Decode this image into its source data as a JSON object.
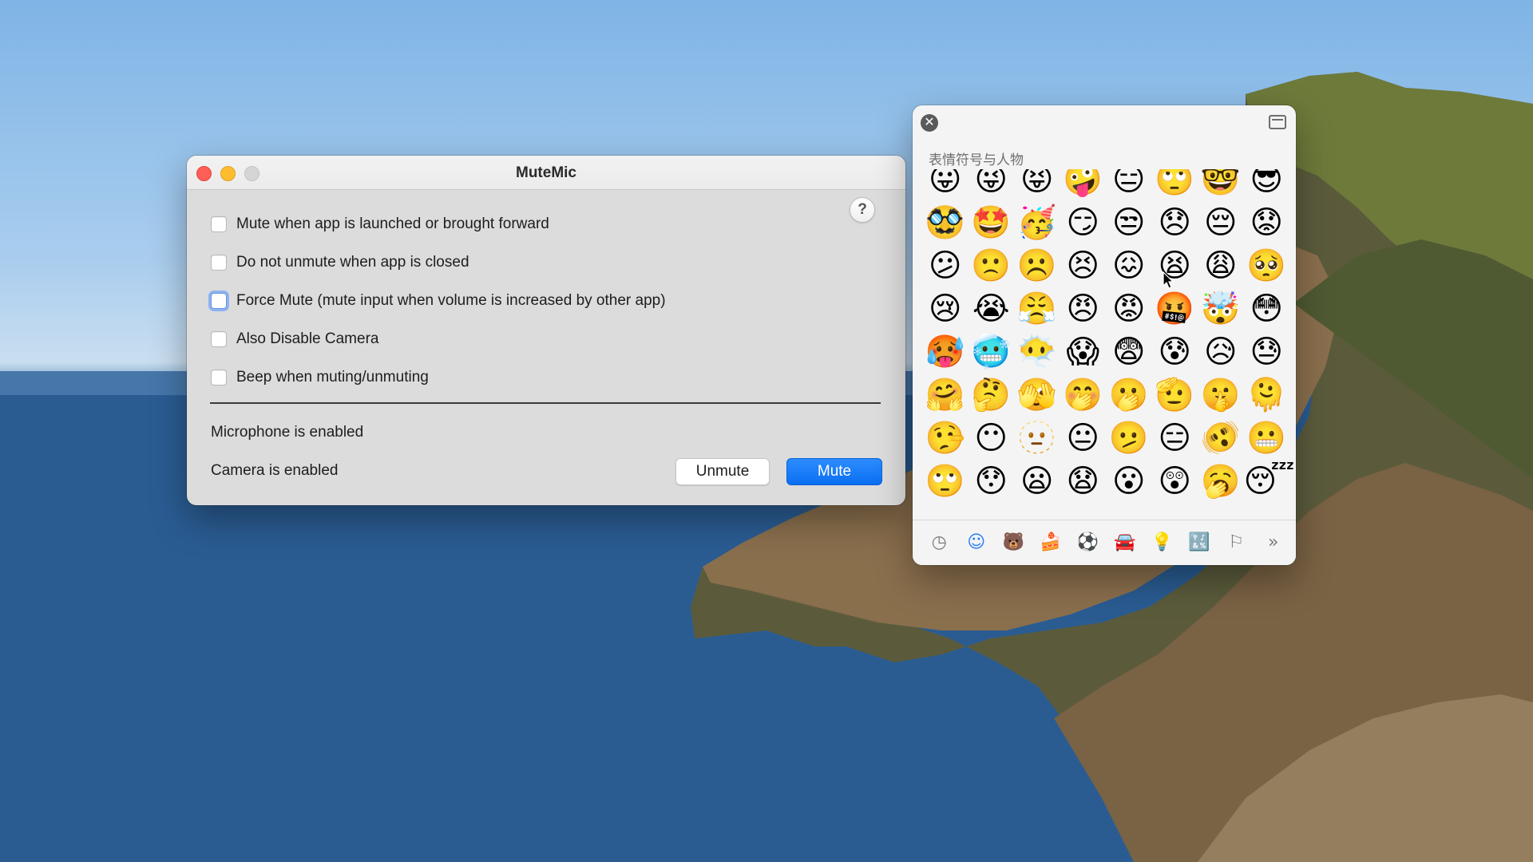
{
  "desktop": {
    "wallpaper": "macOS Catalina island",
    "accent": "#0a6ff2"
  },
  "mutemic": {
    "title": "MuteMic",
    "help_label": "?",
    "options": [
      {
        "label": "Mute when app is launched or brought forward",
        "checked": false,
        "focused": false
      },
      {
        "label": "Do not unmute when app is closed",
        "checked": false,
        "focused": false
      },
      {
        "label": "Force Mute (mute input when volume is increased by other app)",
        "checked": false,
        "focused": true
      },
      {
        "label": "Also Disable Camera",
        "checked": false,
        "focused": false
      },
      {
        "label": "Beep when muting/unmuting",
        "checked": false,
        "focused": false
      }
    ],
    "status_microphone": "Microphone is enabled",
    "status_camera": "Camera is enabled",
    "unmute_label": "Unmute",
    "mute_label": "Mute"
  },
  "emoji_picker": {
    "category_title": "表情符号与人物",
    "rows": [
      [
        "😛",
        "😜",
        "😝",
        "🤪",
        "😑",
        "🙄",
        "🤓",
        "😎"
      ],
      [
        "🥸",
        "🤩",
        "🥳",
        "😏",
        "😒",
        "😞",
        "😔",
        "😟"
      ],
      [
        "😕",
        "🙁",
        "☹️",
        "😣",
        "😖",
        "😫",
        "😩",
        "🥺"
      ],
      [
        "😢",
        "😭",
        "😤",
        "😠",
        "😡",
        "🤬",
        "🤯",
        "😳"
      ],
      [
        "🥵",
        "🥶",
        "😶‍🌫️",
        "😱",
        "😨",
        "😰",
        "😥",
        "😓"
      ],
      [
        "🤗",
        "🤔",
        "🫣",
        "🤭",
        "🫢",
        "🫡",
        "🤫",
        "🫠"
      ],
      [
        "🤥",
        "😶",
        "🫥",
        "😐",
        "🫤",
        "😑",
        "🫨",
        "😬"
      ],
      [
        "🙄",
        "😯",
        "😦",
        "😧",
        "😮",
        "😲",
        "🥱",
        "😴"
      ],
      [
        "😌",
        "😒",
        "😔",
        "😵",
        "😵‍💫",
        "😶",
        "🥴",
        "🤢"
      ]
    ],
    "tabs": [
      {
        "name": "recent",
        "glyph": "◷",
        "active": false
      },
      {
        "name": "smileys-people",
        "glyph": "☺",
        "active": true
      },
      {
        "name": "animals-nature",
        "glyph": "🐻",
        "active": false
      },
      {
        "name": "food-drink",
        "glyph": "🍰",
        "active": false
      },
      {
        "name": "activity",
        "glyph": "⚽",
        "active": false
      },
      {
        "name": "travel-places",
        "glyph": "🚘",
        "active": false
      },
      {
        "name": "objects",
        "glyph": "💡",
        "active": false
      },
      {
        "name": "symbols",
        "glyph": "🔣",
        "active": false
      },
      {
        "name": "flags",
        "glyph": "⚐",
        "active": false
      },
      {
        "name": "more",
        "glyph": "»",
        "active": false
      }
    ]
  }
}
